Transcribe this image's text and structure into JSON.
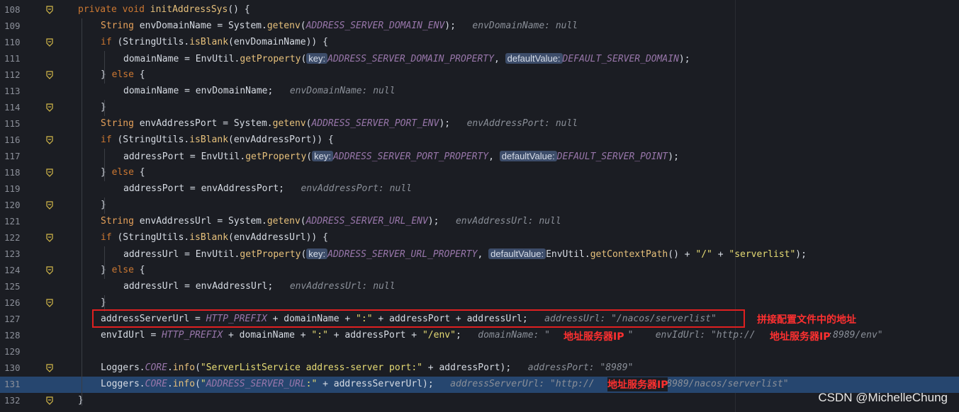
{
  "colors": {
    "background": "#1b1d23",
    "highlight": "#26466f",
    "annotation": "#ff3030",
    "keyword": "#cc7832"
  },
  "icons": {
    "fold": "fold-marker-icon"
  },
  "lines": [
    {
      "num": "108",
      "code": "private void initAddressSys() {"
    },
    {
      "num": "109",
      "code": "String envDomainName = System.getenv(ADDRESS_SERVER_DOMAIN_ENV);",
      "hint": "envDomainName: null"
    },
    {
      "num": "110",
      "code": "if (StringUtils.isBlank(envDomainName)) {"
    },
    {
      "num": "111",
      "code_a": "domainName = EnvUtil.getProperty(",
      "chip1": "key:",
      "mid": "ADDRESS_SERVER_DOMAIN_PROPERTY,",
      "chip2": "defaultValue:",
      "tail": "DEFAULT_SERVER_DOMAIN);"
    },
    {
      "num": "112",
      "code": "} else {"
    },
    {
      "num": "113",
      "code": "domainName = envDomainName;",
      "hint": "envDomainName: null"
    },
    {
      "num": "114",
      "code": "}"
    },
    {
      "num": "115",
      "code": "String envAddressPort = System.getenv(ADDRESS_SERVER_PORT_ENV);",
      "hint": "envAddressPort: null"
    },
    {
      "num": "116",
      "code": "if (StringUtils.isBlank(envAddressPort)) {"
    },
    {
      "num": "117",
      "code_a": "addressPort = EnvUtil.getProperty(",
      "chip1": "key:",
      "mid": "ADDRESS_SERVER_PORT_PROPERTY,",
      "chip2": "defaultValue:",
      "tail": "DEFAULT_SERVER_POINT);"
    },
    {
      "num": "118",
      "code": "} else {"
    },
    {
      "num": "119",
      "code": "addressPort = envAddressPort;",
      "hint": "envAddressPort: null"
    },
    {
      "num": "120",
      "code": "}"
    },
    {
      "num": "121",
      "code": "String envAddressUrl = System.getenv(ADDRESS_SERVER_URL_ENV);",
      "hint": "envAddressUrl: null"
    },
    {
      "num": "122",
      "code": "if (StringUtils.isBlank(envAddressUrl)) {"
    },
    {
      "num": "123",
      "code_a": "addressUrl = EnvUtil.getProperty(",
      "chip1": "key:",
      "mid": "ADDRESS_SERVER_URL_PROPERTY,",
      "chip2": "defaultValue:",
      "tail": "EnvUtil.getContextPath() + \"/\" + \"serverlist\");"
    },
    {
      "num": "124",
      "code": "} else {"
    },
    {
      "num": "125",
      "code": "addressUrl = envAddressUrl;",
      "hint": "envAddressUrl: null"
    },
    {
      "num": "126",
      "code": "}"
    },
    {
      "num": "127",
      "code": "addressServerUrl = HTTP_PREFIX + domainName + \":\" + addressPort + addressUrl;",
      "hint": "addressUrl: \"/nacos/serverlist\""
    },
    {
      "num": "128",
      "code": "envIdUrl = HTTP_PREFIX + domainName + \":\" + addressPort + \"/env\";",
      "hint": "domainName: \"",
      "hint2": "envIdUrl: \"http://",
      "hint2tail": ":8989/env\""
    },
    {
      "num": "129",
      "code": ""
    },
    {
      "num": "130",
      "code": "Loggers.CORE.info(\"ServerListService address-server port:\" + addressPort);",
      "hint": "addressPort: \"8989\""
    },
    {
      "num": "131",
      "code": "Loggers.CORE.info(\"ADDRESS_SERVER_URL:\" + addressServerUrl);",
      "hint": "addressServerUrl: \"http://",
      "hinttail": ":8989/nacos/serverlist\""
    },
    {
      "num": "132",
      "code": "}"
    }
  ],
  "annotations": {
    "note": "拼接配置文件中的地址",
    "ip_label_1": "地址服务器IP",
    "ip_label_2": "地址服务器IP",
    "ip_label_3": "地址服务器IP"
  },
  "watermark": "CSDN @MichelleChung"
}
